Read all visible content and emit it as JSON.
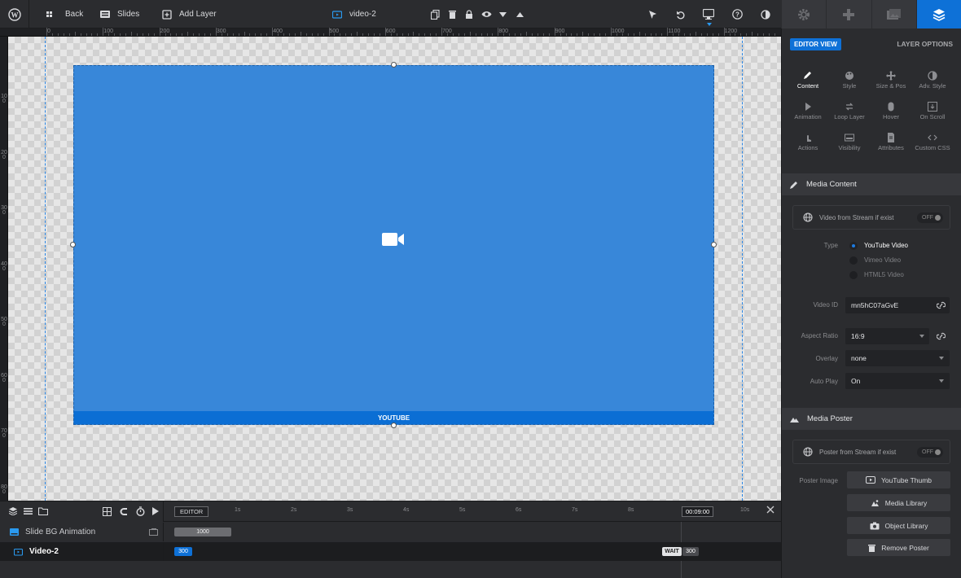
{
  "topbar": {
    "back_label": "Back",
    "slides_label": "Slides",
    "add_layer_label": "Add Layer",
    "layer_name": "video-2"
  },
  "ruler": {
    "h_labels": [
      "0",
      "100",
      "200",
      "300",
      "400",
      "500",
      "600",
      "700",
      "800",
      "900",
      "1000",
      "1100",
      "1200"
    ],
    "v_labels": [
      "100",
      "200",
      "300",
      "400",
      "500",
      "600",
      "700",
      "800"
    ]
  },
  "canvas": {
    "video_bar_label": "YOUTUBE",
    "accent": "#3887d9"
  },
  "timeline": {
    "editor_label": "EDITOR",
    "seconds": [
      "1s",
      "2s",
      "3s",
      "4s",
      "5s",
      "6s",
      "7s",
      "8s",
      "9s",
      "10s"
    ],
    "time_value": "00:09:00",
    "rows": [
      {
        "label": "Slide BG Animation",
        "pill": "1000"
      },
      {
        "label": "Video-2",
        "pill": "300",
        "wait_label": "WAIT",
        "wait_value": "300"
      }
    ]
  },
  "panel": {
    "editor_view": "EDITOR VIEW",
    "layer_options": "LAYER OPTIONS",
    "tools": [
      {
        "label": "Content"
      },
      {
        "label": "Style"
      },
      {
        "label": "Size & Pos"
      },
      {
        "label": "Adv. Style"
      },
      {
        "label": "Animation"
      },
      {
        "label": "Loop Layer"
      },
      {
        "label": "Hover"
      },
      {
        "label": "On Scroll"
      },
      {
        "label": "Actions"
      },
      {
        "label": "Visibility"
      },
      {
        "label": "Attributes"
      },
      {
        "label": "Custom CSS"
      }
    ],
    "media_content": {
      "title": "Media Content",
      "stream_label": "Video from Stream if exist",
      "stream_toggle": "OFF",
      "type_label": "Type",
      "types": [
        "YouTube Video",
        "Vimeo Video",
        "HTML5 Video"
      ],
      "video_id_label": "Video ID",
      "video_id": "mn5hC07aGvE",
      "aspect_label": "Aspect Ratio",
      "aspect_value": "16:9",
      "overlay_label": "Overlay",
      "overlay_value": "none",
      "autoplay_label": "Auto Play",
      "autoplay_value": "On"
    },
    "media_poster": {
      "title": "Media Poster",
      "stream_label": "Poster from Stream if exist",
      "stream_toggle": "OFF",
      "poster_label": "Poster Image",
      "buttons": [
        "YouTube Thumb",
        "Media Library",
        "Object Library",
        "Remove Poster"
      ]
    }
  }
}
